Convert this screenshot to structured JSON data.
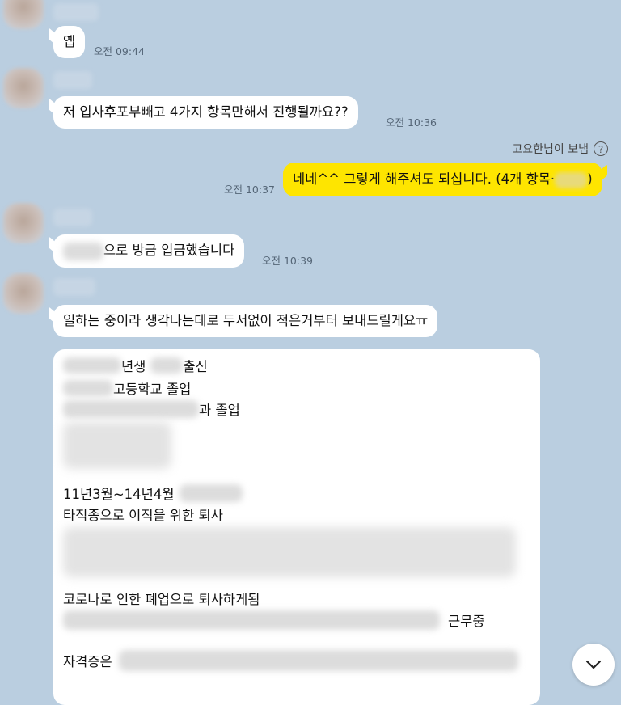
{
  "messages": {
    "m1": {
      "text": "옙",
      "time": "오전 09:44"
    },
    "m2": {
      "text": "저 입사후포부빼고 4가지 항목만해서 진행될까요??",
      "time": "오전 10:36"
    },
    "sender_note": "고요한님이 보냄",
    "m3": {
      "text_prefix": "네네^^ 그렇게 해주셔도 되십니다. (4개 항목·",
      "text_suffix": ")",
      "time": "오전 10:37"
    },
    "m4": {
      "text": "으로 방금 입금했습니다",
      "time": "오전 10:39"
    },
    "m5": {
      "text": "일하는 중이라 생각나는데로 두서없이 적은거부터 보내드릴게요ㅠ"
    }
  },
  "document": {
    "l1a": "년생",
    "l1b": "출신",
    "l2": "고등학교 졸업",
    "l3": "과 졸업",
    "l4": "11년3월~14년4월",
    "l5": "타직종으로 이직을 위한 퇴사",
    "l6": "코로나로 인한 폐업으로 퇴사하게됨",
    "l7": "근무중",
    "l8": "자격증은"
  },
  "icons": {
    "help": "question-circle-icon",
    "scroll": "chevron-down-icon"
  },
  "help_glyph": "?"
}
